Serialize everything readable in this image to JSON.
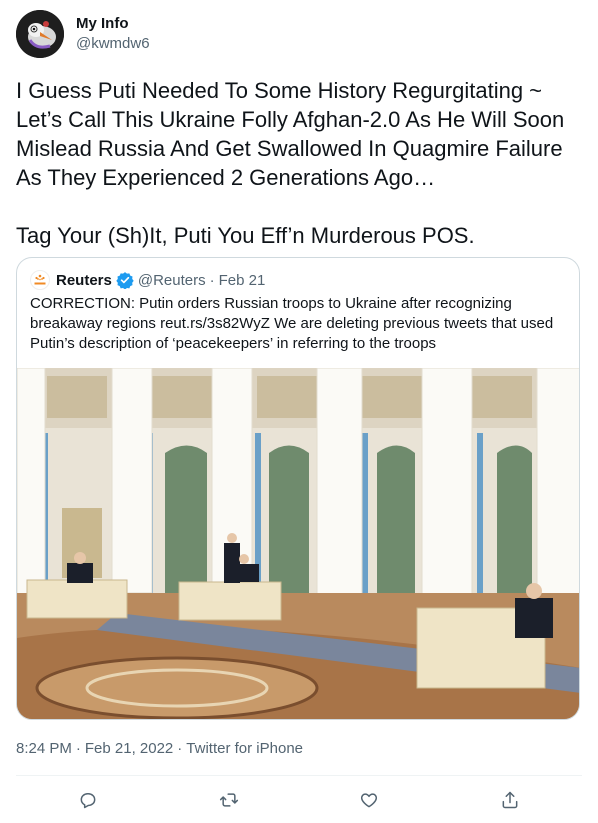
{
  "author": {
    "display_name": "My Info",
    "handle": "@kwmdw6",
    "avatar_icon": "bird-avatar-icon"
  },
  "tweet": {
    "text": "I Guess Puti Needed To Some History Regurgitating ~ Let’s Call This Ukraine Folly Afghan-2.0 As He Will Soon Mislead Russia And Get Swallowed In Quagmire Failure As They Experienced 2 Generations Ago…\n\nTag Your (Sh)It, Puti You Eff’n Murderous POS."
  },
  "quoted": {
    "name": "Reuters",
    "handle": "@Reuters",
    "dot": "·",
    "date": "Feb 21",
    "text": "CORRECTION: Putin orders Russian troops to Ukraine after recognizing breakaway regions reut.rs/3s82WyZ We are deleting previous tweets that used Putin’s description of ‘peacekeepers’ in referring to the troops",
    "image_alt": "photo of ornate Kremlin hall with white columns and desks"
  },
  "meta": {
    "time": "8:24 PM",
    "sep": "·",
    "date": "Feb 21, 2022",
    "sep2": "·",
    "source": "Twitter for iPhone"
  },
  "actions": [
    "reply-icon",
    "retweet-icon",
    "like-icon",
    "share-icon"
  ],
  "colors": {
    "text": "#0f1419",
    "secondary": "#536471",
    "verified": "#1d9bf0",
    "border": "#cfd9de"
  }
}
